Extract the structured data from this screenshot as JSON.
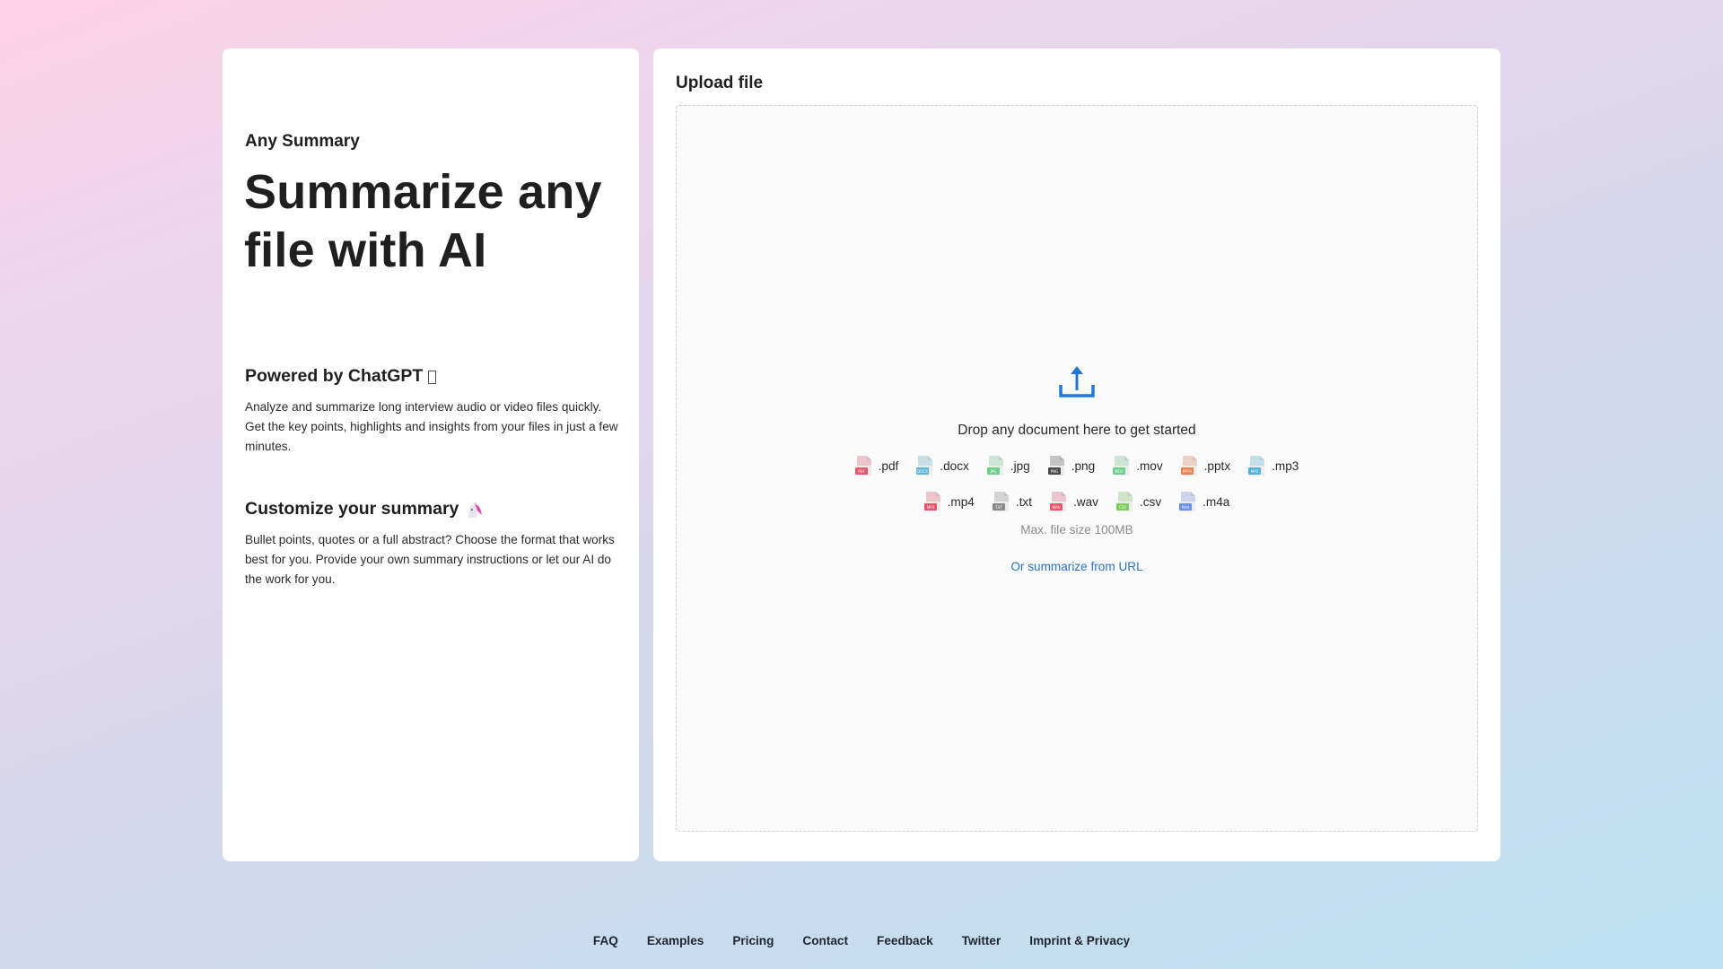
{
  "left": {
    "brand": "Any Summary",
    "headline": "Summarize any file with AI",
    "features": [
      {
        "title": "Powered by ChatGPT",
        "icon": "missing-glyph-icon",
        "text": "Analyze and summarize long interview audio or video files quickly. Get the key points, highlights and insights from your files in just a few minutes."
      },
      {
        "title": "Customize your summary",
        "icon": "unicorn-emoji-icon",
        "text": "Bullet points, quotes or a full abstract? Choose the format that works best for you. Provide your own summary instructions or let our AI do the work for you."
      }
    ]
  },
  "upload": {
    "title": "Upload file",
    "drop_text": "Drop any document here to get started",
    "file_types": [
      {
        "ext": ".pdf",
        "label": "PDF",
        "color": "#e8556b"
      },
      {
        "ext": ".docx",
        "label": "DOCX",
        "color": "#5fb6d9"
      },
      {
        "ext": ".jpg",
        "label": "JPG",
        "color": "#6fcf8a"
      },
      {
        "ext": ".png",
        "label": "PNG",
        "color": "#4a4a4a"
      },
      {
        "ext": ".mov",
        "label": "MOV",
        "color": "#6fcf8a"
      },
      {
        "ext": ".pptx",
        "label": "PPTX",
        "color": "#ef7f4a"
      },
      {
        "ext": ".mp3",
        "label": "MP3",
        "color": "#4fb2da"
      },
      {
        "ext": ".mp4",
        "label": "MP4",
        "color": "#e8556b"
      },
      {
        "ext": ".txt",
        "label": "TXT",
        "color": "#8a8a8a"
      },
      {
        "ext": ".wav",
        "label": "WAV",
        "color": "#e8556b"
      },
      {
        "ext": ".csv",
        "label": "CSV",
        "color": "#7dcc5c"
      },
      {
        "ext": ".m4a",
        "label": "M4A",
        "color": "#6b8ee8"
      }
    ],
    "max_size": "Max. file size 100MB",
    "url_link": "Or summarize from URL",
    "accent": "#1f78d9"
  },
  "footer": {
    "links": [
      "FAQ",
      "Examples",
      "Pricing",
      "Contact",
      "Feedback",
      "Twitter",
      "Imprint & Privacy"
    ]
  }
}
